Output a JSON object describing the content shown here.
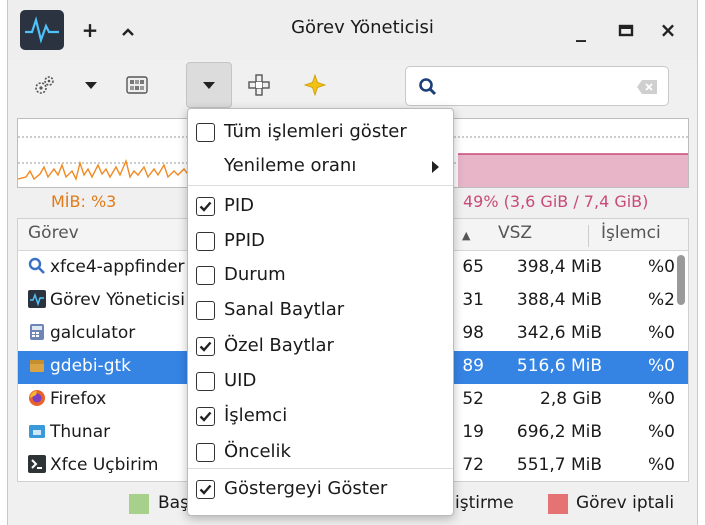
{
  "window": {
    "title": "Görev Yöneticisi",
    "buttons": {
      "pin": "+",
      "shade": "^",
      "minimize": "_",
      "maximize": "□",
      "close": "×"
    }
  },
  "graph": {
    "cpu_label": "MİB: %3",
    "mem_label": "49% (3,6 GiB / 7,4 GiB)",
    "colors": {
      "cpu": "#f08a24",
      "mem": "#c84a78",
      "mem_fill": "#e8b5c8"
    }
  },
  "table": {
    "columns": {
      "name": "Görev",
      "pid_sort": "▲",
      "vsz": "VSZ",
      "cpu": "İşlemci"
    },
    "rows": [
      {
        "name": "xfce4-appfinder",
        "pid": "65",
        "vsz": "398,4 MiB",
        "cpu": "%0",
        "icon": "search-icon",
        "icon_color": "#3a6fc4"
      },
      {
        "name": "Görev Yöneticisi",
        "pid": "31",
        "vsz": "388,4 MiB",
        "cpu": "%2",
        "icon": "task-manager-icon",
        "icon_color": "#2b3240"
      },
      {
        "name": "galculator",
        "pid": "98",
        "vsz": "342,6 MiB",
        "cpu": "%0",
        "icon": "calculator-icon",
        "icon_color": "#6d86b5"
      },
      {
        "name": "gdebi-gtk",
        "pid": "89",
        "vsz": "516,6 MiB",
        "cpu": "%0",
        "icon": "package-icon",
        "icon_color": "#d9a441",
        "selected": true
      },
      {
        "name": "Firefox",
        "pid": "52",
        "vsz": "2,8 GiB",
        "cpu": "%0",
        "icon": "firefox-icon",
        "icon_color": "#e8622a"
      },
      {
        "name": "Thunar",
        "pid": "19",
        "vsz": "696,2 MiB",
        "cpu": "%0",
        "icon": "folder-icon",
        "icon_color": "#3a9ad9"
      },
      {
        "name": "Xfce Uçbirim",
        "pid": "72",
        "vsz": "551,7 MiB",
        "cpu": "%0",
        "icon": "terminal-icon",
        "icon_color": "#2e3436"
      }
    ]
  },
  "legend": [
    {
      "label": "Başlatma",
      "visible_text": "Baş",
      "color": "#a8d08d"
    },
    {
      "label": "Değiştirme",
      "visible_text": "iştirme",
      "color": "#f0b860"
    },
    {
      "label": "Görev iptali",
      "visible_text": "Görev iptali",
      "color": "#e57373"
    }
  ],
  "menu": {
    "items": [
      {
        "label": "Tüm işlemleri göster",
        "checked": false
      },
      {
        "label": "Yenileme oranı",
        "submenu": true
      },
      {
        "label": "PID",
        "checked": true
      },
      {
        "label": "PPID",
        "checked": false
      },
      {
        "label": "Durum",
        "checked": false
      },
      {
        "label": "Sanal Baytlar",
        "checked": false
      },
      {
        "label": "Özel Baytlar",
        "checked": true
      },
      {
        "label": "UID",
        "checked": false
      },
      {
        "label": "İşlemci",
        "checked": true
      },
      {
        "label": "Öncelik",
        "checked": false
      },
      {
        "label": "Göstergeyi Göster",
        "checked": true
      }
    ]
  },
  "search": {
    "placeholder": ""
  }
}
